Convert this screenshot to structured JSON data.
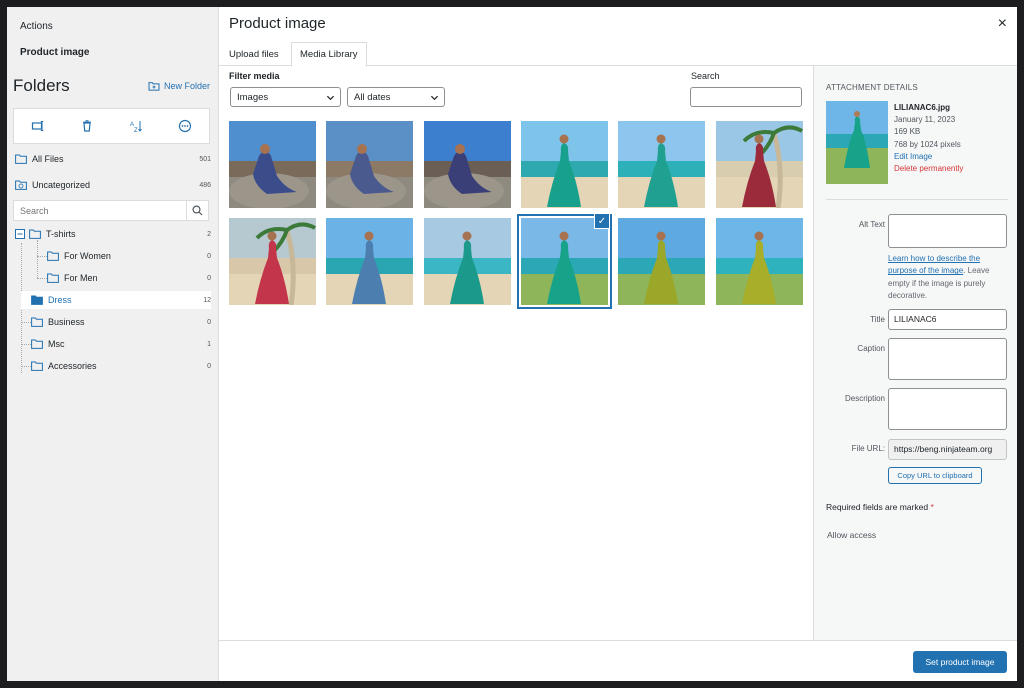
{
  "sidebar": {
    "actions_label": "Actions",
    "product_image_label": "Product image",
    "folders_title": "Folders",
    "new_folder_label": "New Folder",
    "search_placeholder": "Search",
    "all_files": {
      "label": "All Files",
      "count": "501"
    },
    "uncategorized": {
      "label": "Uncategorized",
      "count": "486"
    },
    "tshirts": {
      "label": "T-shirts",
      "count": "2"
    },
    "for_women": {
      "label": "For Women",
      "count": "0"
    },
    "for_men": {
      "label": "For Men",
      "count": "0"
    },
    "dress": {
      "label": "Dress",
      "count": "12"
    },
    "business": {
      "label": "Business",
      "count": "0"
    },
    "msc": {
      "label": "Msc",
      "count": "1"
    },
    "accessories": {
      "label": "Accessories",
      "count": "0"
    }
  },
  "header": {
    "title": "Product image",
    "close": "×",
    "tabs": {
      "upload": "Upload files",
      "library": "Media Library"
    }
  },
  "filter": {
    "label": "Filter media",
    "type_value": "Images",
    "date_value": "All dates",
    "search_label": "Search"
  },
  "grid": {
    "selected_index": 9,
    "check_glyph": "✓"
  },
  "details": {
    "heading": "ATTACHMENT DETAILS",
    "filename": "LILIANAC6.jpg",
    "date": "January 11, 2023",
    "size": "169 KB",
    "dimensions": "768 by 1024 pixels",
    "edit_label": "Edit Image",
    "delete_label": "Delete permanently",
    "alt_text_label": "Alt Text",
    "help_link": "Learn how to describe the purpose of the image",
    "help_text": ". Leave empty if the image is purely decorative.",
    "title_label": "Title",
    "title_value": "LILIANAC6",
    "caption_label": "Caption",
    "description_label": "Description",
    "file_url_label": "File URL:",
    "file_url_value": "https://beng.ninjateam.org",
    "copy_url_label": "Copy URL to clipboard",
    "required_text": "Required fields are marked",
    "required_star": "*",
    "allow_access": "Allow access"
  },
  "footer": {
    "set_button": "Set product image"
  },
  "colors": {
    "accent": "#2271b1",
    "danger": "#d63638"
  }
}
